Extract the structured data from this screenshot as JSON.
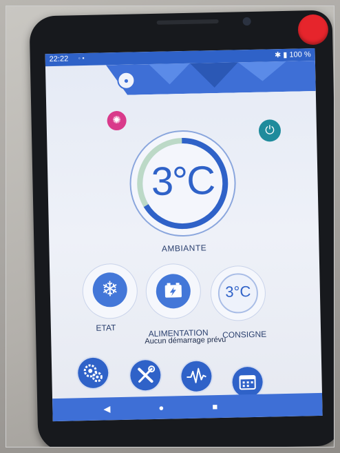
{
  "status_bar": {
    "time": "22:22",
    "battery": "100 %"
  },
  "main": {
    "ambient_temperature": "3°C",
    "ambient_label": "AMBIANTE"
  },
  "tiles": {
    "etat_label": "ETAT",
    "alimentation_label": "ALIMENTATION",
    "consigne_label": "CONSIGNE",
    "consigne_value": "3°C"
  },
  "notice": "Aucun démarrage prévu",
  "icons": {
    "user": "user-icon",
    "light": "lightbulb-icon",
    "power": "power-icon",
    "etat": "snowflake-icon",
    "alimentation": "battery-icon",
    "nav": [
      "gears-icon",
      "tools-icon",
      "waveform-icon",
      "calendar-icon"
    ],
    "system": [
      "back-icon",
      "home-icon",
      "recents-icon"
    ]
  },
  "colors": {
    "accent": "#2f62c8",
    "power": "#1f8b9c",
    "light": "#d93a8b",
    "phone_button": "#e6252c"
  }
}
